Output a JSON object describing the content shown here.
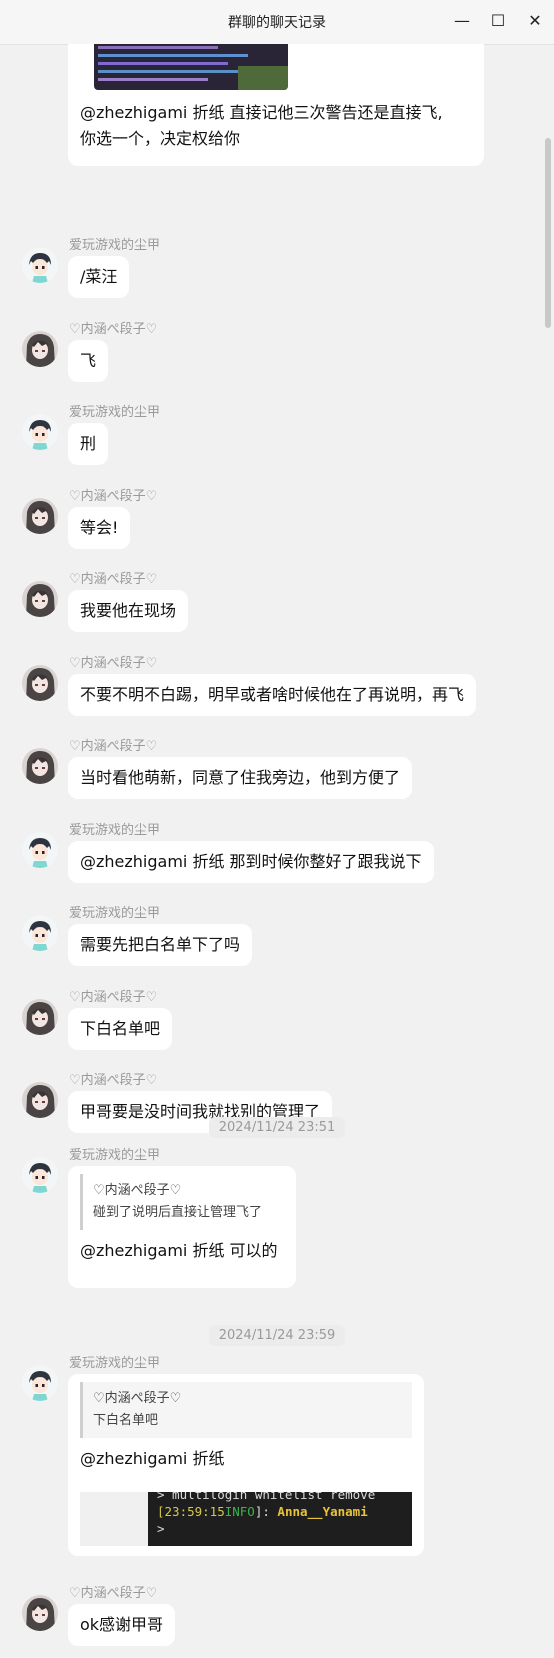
{
  "window": {
    "title": "群聊的聊天记录",
    "minimize_icon": "—",
    "maximize_icon": "☐",
    "close_icon": "✕"
  },
  "top_message": {
    "text_line1": " @zhezhigami 折纸 直接记他三次警告还是直接飞,",
    "text_line2": "你选一个，决定权给你"
  },
  "messages": [
    {
      "sender": "爱玩游戏的尘甲",
      "avatar": "anime-boy",
      "text": "/菜汪"
    },
    {
      "sender": "♡内涵ぺ段子♡",
      "avatar": "anime-girl",
      "text": "飞"
    },
    {
      "sender": "爱玩游戏的尘甲",
      "avatar": "anime-boy",
      "text": "刑"
    },
    {
      "sender": "♡内涵ぺ段子♡",
      "avatar": "anime-girl",
      "text": "等会!"
    },
    {
      "sender": "♡内涵ぺ段子♡",
      "avatar": "anime-girl",
      "text": "我要他在现场"
    },
    {
      "sender": "♡内涵ぺ段子♡",
      "avatar": "anime-girl",
      "text": "不要不明不白踢，明早或者啥时候他在了再说明，再飞"
    },
    {
      "sender": "♡内涵ぺ段子♡",
      "avatar": "anime-girl",
      "text": "当时看他萌新，同意了住我旁边，他到方便了"
    },
    {
      "sender": "爱玩游戏的尘甲",
      "avatar": "anime-boy",
      "text": "@zhezhigami 折纸 那到时候你整好了跟我说下"
    },
    {
      "sender": "爱玩游戏的尘甲",
      "avatar": "anime-boy",
      "text": "需要先把白名单下了吗"
    },
    {
      "sender": "♡内涵ぺ段子♡",
      "avatar": "anime-girl",
      "text": "下白名单吧"
    },
    {
      "sender": "♡内涵ぺ段子♡",
      "avatar": "anime-girl",
      "text": "甲哥要是没时间我就找别的管理了"
    }
  ],
  "timestamp1": "2024/11/24 23:51",
  "quoted_msg1": {
    "sender": "爱玩游戏的尘甲",
    "quote_author": "♡内涵ぺ段子♡",
    "quote_text": "碰到了说明后直接让管理飞了",
    "text": "@zhezhigami 折纸 可以的"
  },
  "timestamp2": "2024/11/24 23:59",
  "quoted_msg2": {
    "sender": "爱玩游戏的尘甲",
    "quote_author": "♡内涵ぺ段子♡",
    "quote_text": "下白名单吧",
    "text": "@zhezhigami 折纸",
    "terminal": {
      "line1": "> multilogin whitelist remove",
      "time": "[23:59:15",
      "level": "INFO",
      "after_level": "]: ",
      "name": "Anna__Yanami",
      "prompt": ">"
    }
  },
  "last_message": {
    "sender": "♡内涵ぺ段子♡",
    "avatar": "anime-girl",
    "text": "ok感谢甲哥"
  }
}
